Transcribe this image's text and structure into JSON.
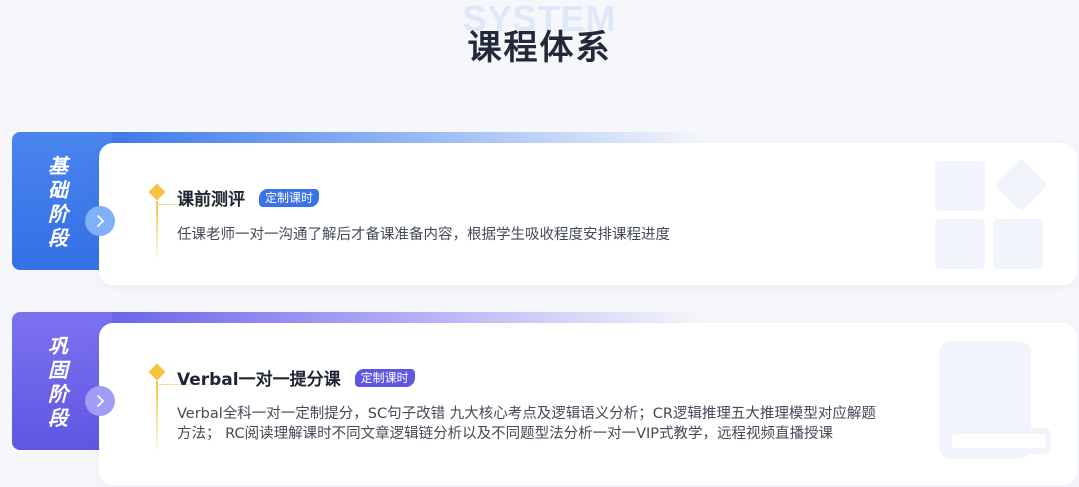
{
  "header": {
    "bg_text": "SYSTEM",
    "title": "课程体系"
  },
  "stages": [
    {
      "label": "基础阶段",
      "course_title": "课前测评",
      "badge": "定制课时",
      "description": "任课老师一对一沟通了解后才备课准备内容，根据学生吸收程度安排课程进度"
    },
    {
      "label": "巩固阶段",
      "course_title": "Verbal一对一提分课",
      "badge": "定制课时",
      "description": "Verbal全科一对一定制提分，SC句子改错 九大核心考点及逻辑语义分析；CR逻辑推理五大推理模型对应解题方法； RC阅读理解课时不同文章逻辑链分析以及不同题型法分析一对一VIP式教学，远程视频直播授课"
    }
  ],
  "colors": {
    "stage1_accent": "#3a72e8",
    "stage2_accent": "#5f56e3",
    "diamond": "#f7c23f"
  },
  "icons": {
    "arrow": "chevron-right-icon",
    "stage1_deco": "grid-blocks-icon",
    "stage2_deco": "book-icon"
  }
}
